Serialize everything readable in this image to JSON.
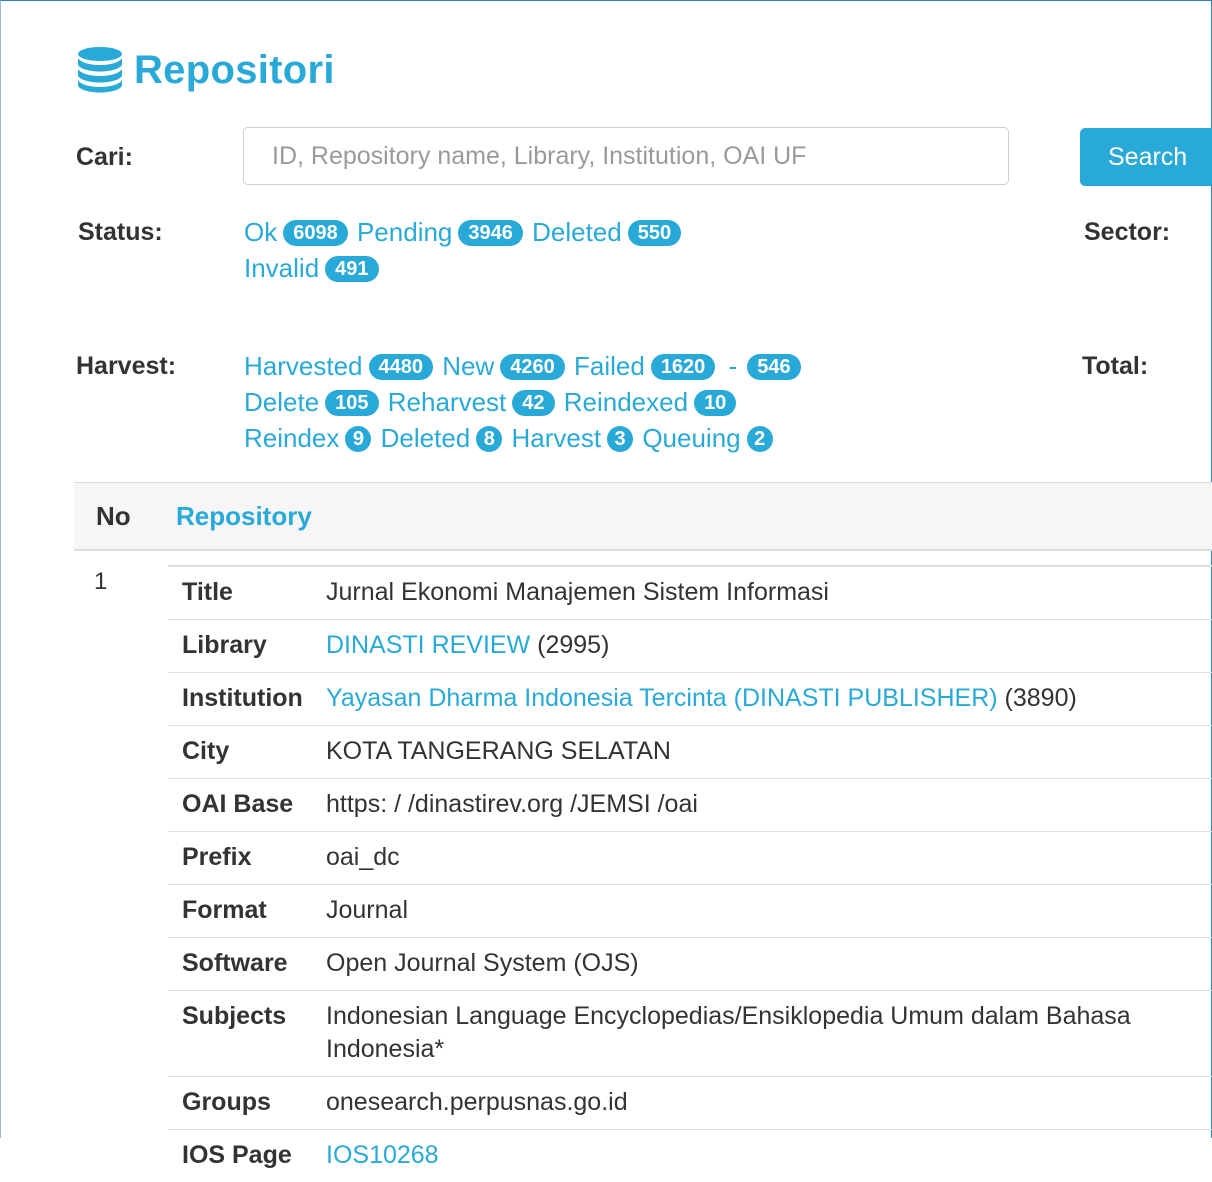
{
  "header": {
    "title": "Repositori",
    "icon": "database-icon",
    "accent_color": "#29a9d8"
  },
  "search": {
    "label": "Cari:",
    "placeholder": "ID, Repository name, Library, Institution, OAI UF",
    "value": "",
    "button_label": "Search"
  },
  "status": {
    "label": "Status:",
    "items": [
      {
        "label": "Ok",
        "count": "6098"
      },
      {
        "label": "Pending",
        "count": "3946"
      },
      {
        "label": "Deleted",
        "count": "550"
      },
      {
        "label": "Invalid",
        "count": "491"
      }
    ]
  },
  "sector": {
    "label": "Sector:"
  },
  "harvest": {
    "label": "Harvest:",
    "items": [
      {
        "label": "Harvested",
        "count": "4480"
      },
      {
        "label": "New",
        "count": "4260"
      },
      {
        "label": "Failed",
        "count": "1620"
      },
      {
        "label": "-",
        "count": "546"
      },
      {
        "label": "Delete",
        "count": "105"
      },
      {
        "label": "Reharvest",
        "count": "42"
      },
      {
        "label": "Reindexed",
        "count": "10"
      },
      {
        "label": "Reindex",
        "count": "9"
      },
      {
        "label": "Deleted",
        "count": "8"
      },
      {
        "label": "Harvest",
        "count": "3"
      },
      {
        "label": "Queuing",
        "count": "2"
      }
    ]
  },
  "total": {
    "label": "Total:"
  },
  "table": {
    "col_no": "No",
    "col_repository": "Repository",
    "rows": [
      {
        "no": "1",
        "fields": {
          "title_key": "Title",
          "title": "Jurnal Ekonomi Manajemen Sistem Informasi",
          "library_key": "Library",
          "library_link": "DINASTI REVIEW",
          "library_count": "(2995)",
          "institution_key": "Institution",
          "institution_link": "Yayasan Dharma Indonesia Tercinta (DINASTI PUBLISHER)",
          "institution_count": "(3890)",
          "city_key": "City",
          "city": "KOTA TANGERANG SELATAN",
          "oai_key": "OAI Base",
          "oai": "https: / /dinastirev.org /JEMSI /oai",
          "prefix_key": "Prefix",
          "prefix": "oai_dc",
          "format_key": "Format",
          "format": "Journal",
          "software_key": "Software",
          "software": "Open Journal System (OJS)",
          "subjects_key": "Subjects",
          "subjects": "Indonesian Language Encyclopedias/Ensiklopedia Umum dalam Bahasa Indonesia*",
          "groups_key": "Groups",
          "groups": "onesearch.perpusnas.go.id",
          "ios_key": "IOS Page",
          "ios": "IOS10268"
        }
      }
    ]
  }
}
